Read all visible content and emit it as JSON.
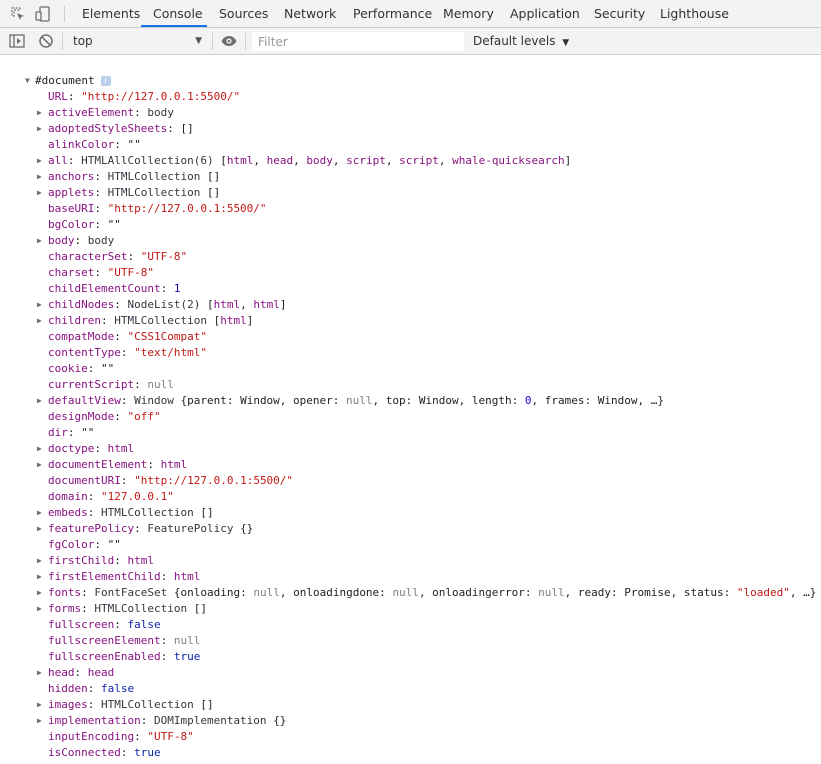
{
  "tabs": [
    "Elements",
    "Console",
    "Sources",
    "Network",
    "Performance",
    "Memory",
    "Application",
    "Security",
    "Lighthouse"
  ],
  "active_tab": "Console",
  "toolbar": {
    "context": "top",
    "filter_placeholder": "Filter",
    "levels": "Default levels"
  },
  "icons": {
    "inspect": "inspect-element-icon",
    "device": "device-toolbar-icon",
    "sidebar": "show-sidebar-icon",
    "clear": "clear-console-icon",
    "eye": "live-expression-eye-icon",
    "info": "info-icon"
  },
  "root": {
    "label": "#document",
    "info": "i"
  },
  "properties": [
    {
      "exp": false,
      "key": "URL",
      "segs": [
        [
          "s",
          "\"http://127.0.0.1:5500/\""
        ]
      ]
    },
    {
      "exp": true,
      "key": "activeElement",
      "segs": [
        [
          "t",
          "body"
        ]
      ]
    },
    {
      "exp": true,
      "key": "adoptedStyleSheets",
      "segs": [
        [
          "p",
          "[]"
        ]
      ]
    },
    {
      "exp": false,
      "key": "alinkColor",
      "segs": [
        [
          "p",
          "\"\""
        ]
      ]
    },
    {
      "exp": true,
      "key": "all",
      "segs": [
        [
          "t",
          "HTMLAllCollection(6) "
        ],
        [
          "p",
          "["
        ],
        [
          "k",
          "html"
        ],
        [
          "p",
          ", "
        ],
        [
          "k",
          "head"
        ],
        [
          "p",
          ", "
        ],
        [
          "k",
          "body"
        ],
        [
          "p",
          ", "
        ],
        [
          "k",
          "script"
        ],
        [
          "p",
          ", "
        ],
        [
          "k",
          "script"
        ],
        [
          "p",
          ", "
        ],
        [
          "k",
          "whale-quicksearch"
        ],
        [
          "p",
          "]"
        ]
      ]
    },
    {
      "exp": true,
      "key": "anchors",
      "segs": [
        [
          "t",
          "HTMLCollection "
        ],
        [
          "p",
          "[]"
        ]
      ]
    },
    {
      "exp": true,
      "key": "applets",
      "segs": [
        [
          "t",
          "HTMLCollection "
        ],
        [
          "p",
          "[]"
        ]
      ]
    },
    {
      "exp": false,
      "key": "baseURI",
      "segs": [
        [
          "s",
          "\"http://127.0.0.1:5500/\""
        ]
      ]
    },
    {
      "exp": false,
      "key": "bgColor",
      "segs": [
        [
          "p",
          "\"\""
        ]
      ]
    },
    {
      "exp": true,
      "key": "body",
      "segs": [
        [
          "t",
          "body"
        ]
      ]
    },
    {
      "exp": false,
      "key": "characterSet",
      "segs": [
        [
          "s",
          "\"UTF-8\""
        ]
      ]
    },
    {
      "exp": false,
      "key": "charset",
      "segs": [
        [
          "s",
          "\"UTF-8\""
        ]
      ]
    },
    {
      "exp": false,
      "key": "childElementCount",
      "segs": [
        [
          "n",
          "1"
        ]
      ]
    },
    {
      "exp": true,
      "key": "childNodes",
      "segs": [
        [
          "t",
          "NodeList(2) "
        ],
        [
          "p",
          "["
        ],
        [
          "k",
          "html"
        ],
        [
          "p",
          ", "
        ],
        [
          "k",
          "html"
        ],
        [
          "p",
          "]"
        ]
      ]
    },
    {
      "exp": true,
      "key": "children",
      "segs": [
        [
          "t",
          "HTMLCollection "
        ],
        [
          "p",
          "["
        ],
        [
          "k",
          "html"
        ],
        [
          "p",
          "]"
        ]
      ]
    },
    {
      "exp": false,
      "key": "compatMode",
      "segs": [
        [
          "s",
          "\"CSS1Compat\""
        ]
      ]
    },
    {
      "exp": false,
      "key": "contentType",
      "segs": [
        [
          "s",
          "\"text/html\""
        ]
      ]
    },
    {
      "exp": false,
      "key": "cookie",
      "segs": [
        [
          "p",
          "\"\""
        ]
      ]
    },
    {
      "exp": false,
      "key": "currentScript",
      "segs": [
        [
          "nl",
          "null"
        ]
      ]
    },
    {
      "exp": true,
      "key": "defaultView",
      "segs": [
        [
          "t",
          "Window "
        ],
        [
          "p",
          "{parent: Window, opener: "
        ],
        [
          "nl",
          "null"
        ],
        [
          "p",
          ", top: Window, length: "
        ],
        [
          "n",
          "0"
        ],
        [
          "p",
          ", frames: Window, …}"
        ]
      ]
    },
    {
      "exp": false,
      "key": "designMode",
      "segs": [
        [
          "s",
          "\"off\""
        ]
      ]
    },
    {
      "exp": false,
      "key": "dir",
      "segs": [
        [
          "p",
          "\"\""
        ]
      ]
    },
    {
      "exp": true,
      "key": "doctype",
      "segs": [
        [
          "k",
          "html"
        ]
      ]
    },
    {
      "exp": true,
      "key": "documentElement",
      "segs": [
        [
          "k",
          "html"
        ]
      ]
    },
    {
      "exp": false,
      "key": "documentURI",
      "segs": [
        [
          "s",
          "\"http://127.0.0.1:5500/\""
        ]
      ]
    },
    {
      "exp": false,
      "key": "domain",
      "segs": [
        [
          "s",
          "\"127.0.0.1\""
        ]
      ]
    },
    {
      "exp": true,
      "key": "embeds",
      "segs": [
        [
          "t",
          "HTMLCollection "
        ],
        [
          "p",
          "[]"
        ]
      ]
    },
    {
      "exp": true,
      "key": "featurePolicy",
      "segs": [
        [
          "t",
          "FeaturePolicy "
        ],
        [
          "p",
          "{}"
        ]
      ]
    },
    {
      "exp": false,
      "key": "fgColor",
      "segs": [
        [
          "p",
          "\"\""
        ]
      ]
    },
    {
      "exp": true,
      "key": "firstChild",
      "segs": [
        [
          "k",
          "html"
        ]
      ]
    },
    {
      "exp": true,
      "key": "firstElementChild",
      "segs": [
        [
          "k",
          "html"
        ]
      ]
    },
    {
      "exp": true,
      "key": "fonts",
      "segs": [
        [
          "t",
          "FontFaceSet "
        ],
        [
          "p",
          "{onloading: "
        ],
        [
          "nl",
          "null"
        ],
        [
          "p",
          ", onloadingdone: "
        ],
        [
          "nl",
          "null"
        ],
        [
          "p",
          ", onloadingerror: "
        ],
        [
          "nl",
          "null"
        ],
        [
          "p",
          ", ready: Promise, status: "
        ],
        [
          "s",
          "\"loaded\""
        ],
        [
          "p",
          ", …}"
        ]
      ]
    },
    {
      "exp": true,
      "key": "forms",
      "segs": [
        [
          "t",
          "HTMLCollection "
        ],
        [
          "p",
          "[]"
        ]
      ]
    },
    {
      "exp": false,
      "key": "fullscreen",
      "segs": [
        [
          "kw",
          "false"
        ]
      ]
    },
    {
      "exp": false,
      "key": "fullscreenElement",
      "segs": [
        [
          "nl",
          "null"
        ]
      ]
    },
    {
      "exp": false,
      "key": "fullscreenEnabled",
      "segs": [
        [
          "kw",
          "true"
        ]
      ]
    },
    {
      "exp": true,
      "key": "head",
      "segs": [
        [
          "k",
          "head"
        ]
      ]
    },
    {
      "exp": false,
      "key": "hidden",
      "segs": [
        [
          "kw",
          "false"
        ]
      ]
    },
    {
      "exp": true,
      "key": "images",
      "segs": [
        [
          "t",
          "HTMLCollection "
        ],
        [
          "p",
          "[]"
        ]
      ]
    },
    {
      "exp": true,
      "key": "implementation",
      "segs": [
        [
          "t",
          "DOMImplementation "
        ],
        [
          "p",
          "{}"
        ]
      ]
    },
    {
      "exp": false,
      "key": "inputEncoding",
      "segs": [
        [
          "s",
          "\"UTF-8\""
        ]
      ]
    },
    {
      "exp": false,
      "key": "isConnected",
      "segs": [
        [
          "kw",
          "true"
        ]
      ]
    }
  ]
}
